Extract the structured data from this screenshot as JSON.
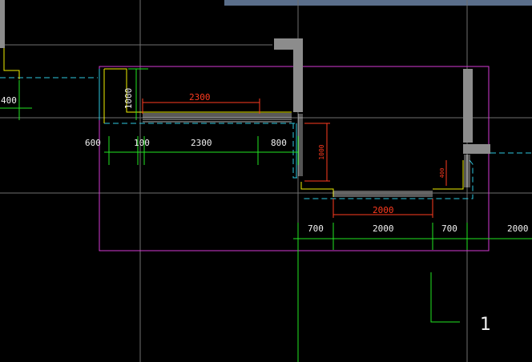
{
  "colors": {
    "background": "#000000",
    "grid": "#6f6f6f",
    "dim_green": "#22e622",
    "dim_red": "#ff3b1f",
    "wall_grey": "#8c8c8c",
    "magenta": "#d43ad4",
    "cyan": "#2ec8e0",
    "yellow": "#f0f000",
    "white": "#f2f2f2",
    "topbar": "#5a6e8a"
  },
  "dimensions": {
    "left_edge": "400",
    "vertical_1000": "1000",
    "top_2300": "2300",
    "row_600": "600",
    "row_100": "100",
    "row_2300": "2300",
    "row_800": "800",
    "vertical_red": "1000",
    "small_red": "400",
    "mid_2000": "2000",
    "bottom_700_left": "700",
    "bottom_2000": "2000",
    "bottom_700_right": "700",
    "bottom_2000_right": "2000"
  },
  "ucs": {
    "label": "1",
    "icon": "ucs-axis-icon"
  }
}
